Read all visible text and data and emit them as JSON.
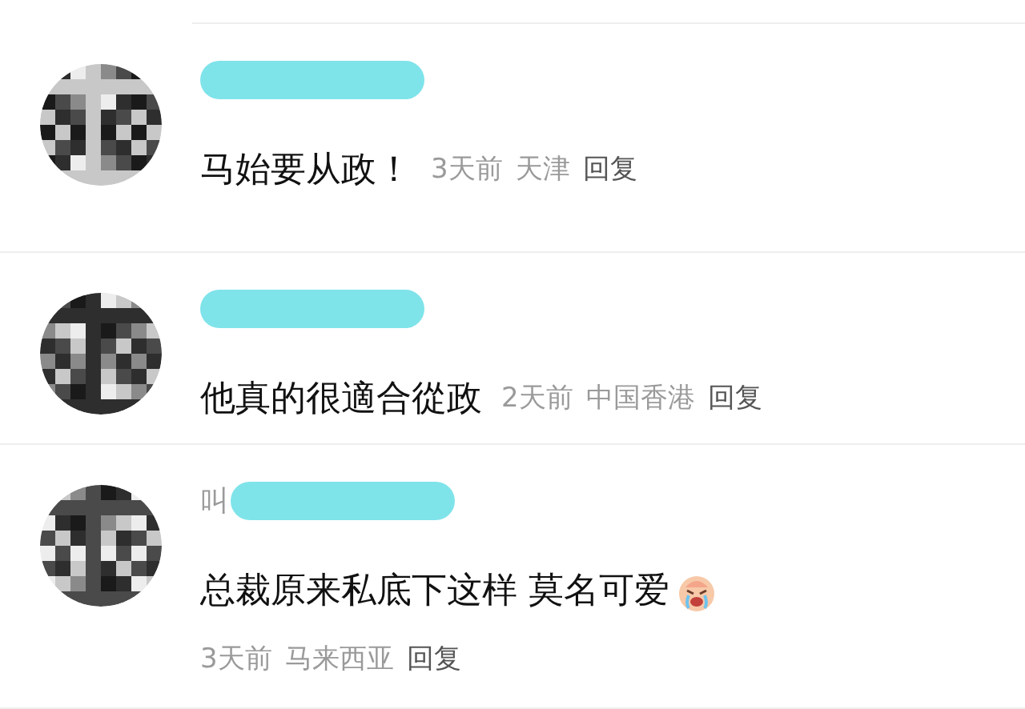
{
  "comments": [
    {
      "kind": "inline",
      "text": "马始要从政！",
      "time": "3天前",
      "location": "天津",
      "reply": "回复",
      "has_emoji": false
    },
    {
      "kind": "inline",
      "text": "他真的很適合從政",
      "time": "2天前",
      "location": "中国香港",
      "reply": "回复",
      "has_emoji": false
    },
    {
      "kind": "wrapped",
      "name_prefix": "叫",
      "text": "总裁原来私底下这样 莫名可爱",
      "time": "3天前",
      "location": "马来西亚",
      "reply": "回复",
      "has_emoji": true
    }
  ]
}
